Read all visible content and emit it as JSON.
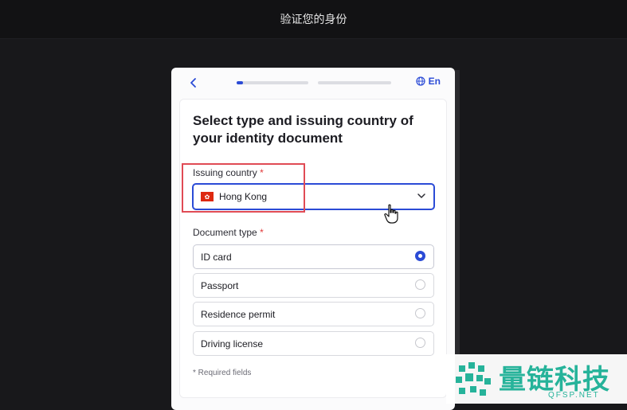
{
  "header": {
    "title": "验证您的身份"
  },
  "nav": {
    "back_icon": "chevron-left-icon",
    "progress_step": 1,
    "progress_total": 2,
    "step1_fill": 0.09,
    "language": "En",
    "language_icon": "globe-icon"
  },
  "form": {
    "title": "Select type and issuing country of your identity document",
    "country": {
      "label": "Issuing country",
      "required_mark": "*",
      "value": "Hong Kong",
      "flag_icon": "hong-kong-flag-icon",
      "dropdown_icon": "chevron-down-icon"
    },
    "document_type": {
      "label": "Document type",
      "required_mark": "*",
      "options": [
        {
          "label": "ID card",
          "selected": true
        },
        {
          "label": "Passport",
          "selected": false
        },
        {
          "label": "Residence permit",
          "selected": false
        },
        {
          "label": "Driving license",
          "selected": false
        }
      ]
    },
    "footnote": "* Required fields"
  },
  "overlay": {
    "highlight_color": "#e04b55",
    "cursor_icon": "hand-pointer-cursor-icon"
  },
  "watermark": {
    "logo_icon": "qfsp-logo-icon",
    "brand_text": "量链科技",
    "url_text": "QFSP.NET",
    "color": "#26b39a"
  },
  "colors": {
    "accent": "#2b4bd6",
    "page_background": "#18181b",
    "required": "#e23a3a"
  }
}
